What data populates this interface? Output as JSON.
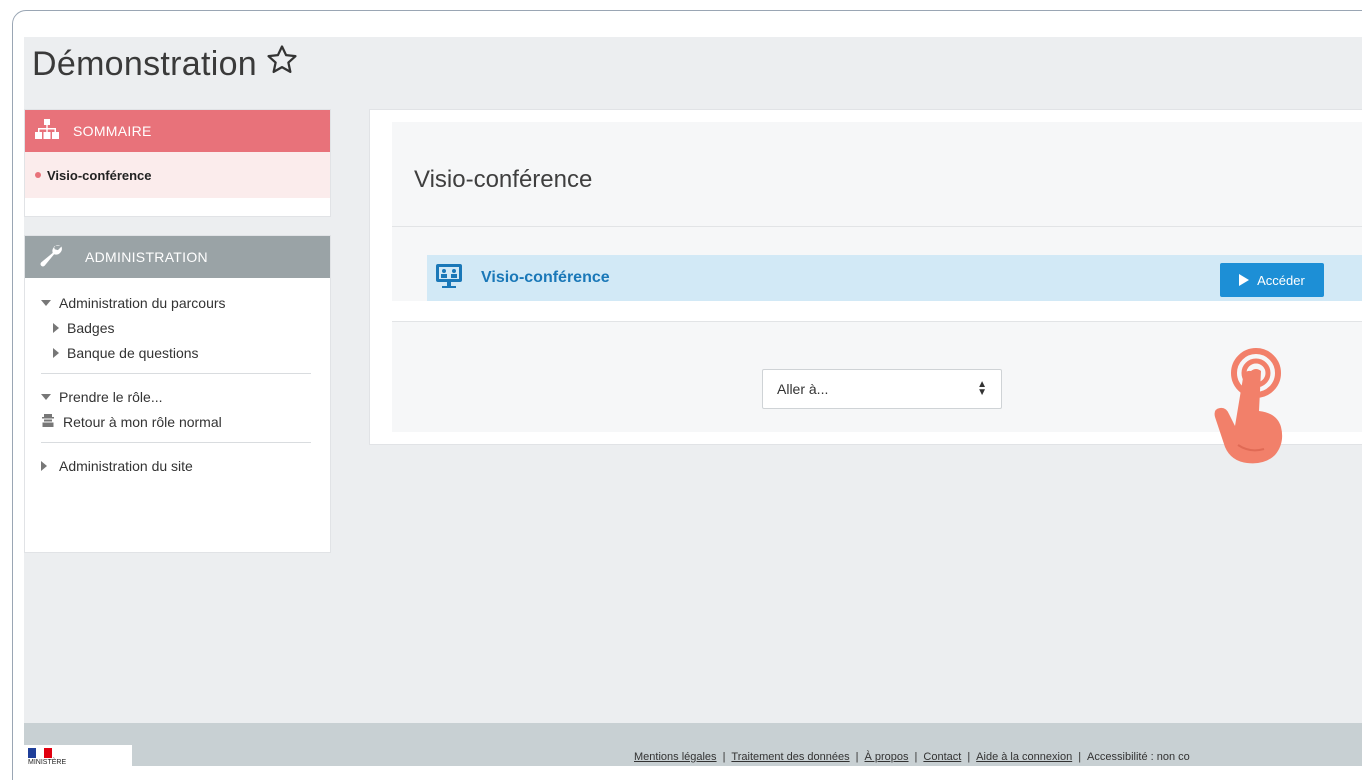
{
  "page": {
    "title": "Démonstration"
  },
  "sommaire": {
    "title": "SOMMAIRE",
    "current": "Visio-conférence"
  },
  "administration": {
    "title": "ADMINISTRATION",
    "items": {
      "parcours": "Administration du parcours",
      "badges": "Badges",
      "banque": "Banque de questions",
      "role": "Prendre le rôle...",
      "retour": "Retour à mon rôle normal",
      "site": "Administration du site"
    }
  },
  "main": {
    "section_title": "Visio-conférence",
    "activity": {
      "name": "Visio-conférence",
      "button": "Accéder"
    },
    "jump": {
      "selected": "Aller à..."
    }
  },
  "footer": {
    "logo_text": "MINISTÈRE",
    "links": {
      "mentions": "Mentions légales",
      "traitement": "Traitement des données",
      "apropos": "À propos",
      "contact": "Contact",
      "aide": "Aide à la connexion"
    },
    "accessibility": "Accessibilité : non co"
  },
  "colors": {
    "sommaire_header": "#e8727a",
    "admin_header": "#9aa3a6",
    "activity_bg": "#d2e9f6",
    "accent": "#1d8fd6",
    "hand": "#f2806a"
  }
}
